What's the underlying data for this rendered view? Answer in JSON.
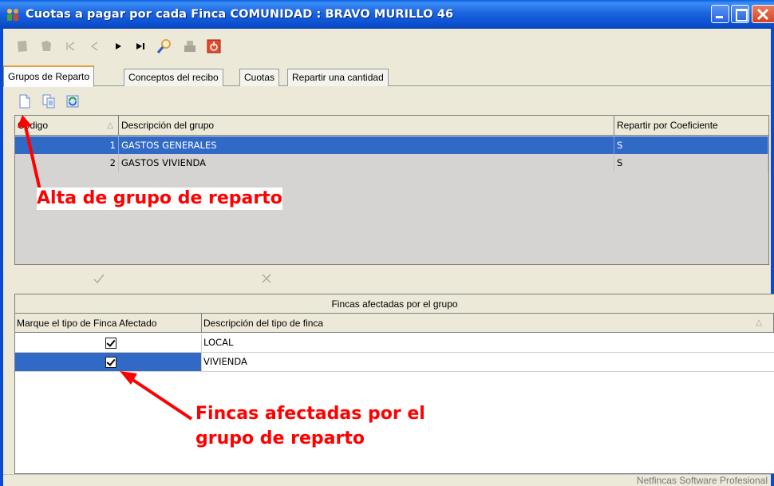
{
  "window": {
    "title": "Cuotas a pagar por cada Finca COMUNIDAD : BRAVO MURILLO 46"
  },
  "navbar": {
    "buttons": [
      "first-record-icon",
      "prior-icon",
      "skip-back-icon",
      "previous-icon",
      "next-icon",
      "last-icon",
      "search-icon",
      "print-icon",
      "power-icon"
    ]
  },
  "tabs": [
    {
      "label": "Grupos de Reparto",
      "active": true
    },
    {
      "label": "Conceptos del recibo",
      "active": false
    },
    {
      "label": "Cuotas",
      "active": false
    },
    {
      "label": "Repartir una cantidad",
      "active": false
    }
  ],
  "toolbar2": {
    "buttons": [
      "new-document-icon",
      "copy-document-icon",
      "refresh-icon"
    ]
  },
  "groups_grid": {
    "columns": [
      "Código",
      "Descripción del grupo",
      "Repartir por Coeficiente"
    ],
    "rows": [
      {
        "codigo": "1",
        "descripcion": "GASTOS GENERALES",
        "repartir": "S",
        "selected": true
      },
      {
        "codigo": "2",
        "descripcion": "GASTOS VIVIENDA",
        "repartir": "S",
        "selected": false
      }
    ]
  },
  "okcancel": {
    "confirm_icon": "check-icon",
    "cancel_icon": "x-icon"
  },
  "fincas_grid": {
    "band": "Fincas afectadas por el grupo",
    "columns": [
      "Marque el tipo de Finca Afectado",
      "Descripción del tipo de finca"
    ],
    "rows": [
      {
        "checked": true,
        "descripcion": "LOCAL",
        "selected": false
      },
      {
        "checked": true,
        "descripcion": "VIVIENDA",
        "selected": true
      }
    ]
  },
  "annotations": {
    "alta": "Alta de grupo de reparto",
    "fincas_line1": "Fincas afectadas por el",
    "fincas_line2": "grupo de reparto"
  },
  "status": {
    "text": "Netfincas Software Profesional"
  },
  "colors": {
    "selection": "#3169c6",
    "annotation": "#ff0000",
    "titlebar": "#0a5fe0"
  }
}
